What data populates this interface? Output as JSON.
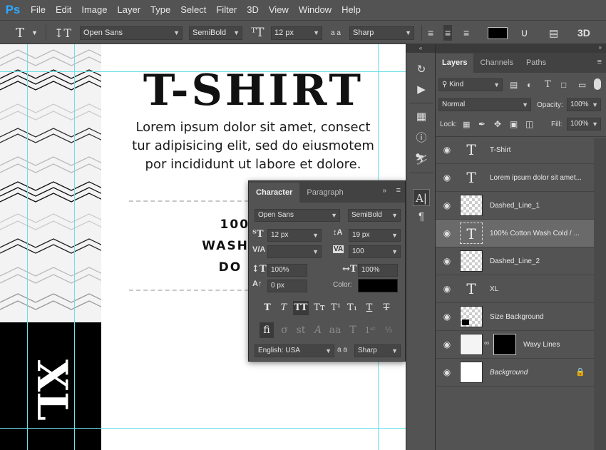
{
  "app": {
    "logo": "Ps"
  },
  "menu": [
    "File",
    "Edit",
    "Image",
    "Layer",
    "Type",
    "Select",
    "Filter",
    "3D",
    "View",
    "Window",
    "Help"
  ],
  "options_bar": {
    "font_family": "Open Sans",
    "font_style": "SemiBold",
    "font_size": "12 px",
    "aa_label": "a a",
    "antialias": "Sharp",
    "label_3d": "3D",
    "color": "#000000"
  },
  "canvas": {
    "title": "T-SHIRT",
    "lorem_lines": [
      "Lorem ipsum dolor sit amet, consect",
      "tur adipisicing elit, sed do eiusmotem",
      "por incididunt ut labore et dolore."
    ],
    "cotton_lines": [
      "100% C",
      "WASH COLD",
      "DO NOT"
    ],
    "size": "XL"
  },
  "character_panel": {
    "tabs": [
      "Character",
      "Paragraph"
    ],
    "font_family": "Open Sans",
    "font_style": "SemiBold",
    "font_size": "12 px",
    "leading": "19 px",
    "kerning": "",
    "tracking": "100",
    "vertical_scale": "100%",
    "horizontal_scale": "100%",
    "baseline_shift": "0 px",
    "color_label": "Color:",
    "color": "#000000",
    "language": "English: USA",
    "aa_label": "a a",
    "antialias": "Sharp"
  },
  "layers_panel": {
    "tabs": [
      "Layers",
      "Channels",
      "Paths"
    ],
    "filter": "Kind",
    "blend_mode": "Normal",
    "opacity_label": "Opacity:",
    "opacity": "100%",
    "lock_label": "Lock:",
    "fill_label": "Fill:",
    "fill": "100%",
    "layers": [
      {
        "name": "T-Shirt",
        "kind": "type",
        "selected": false
      },
      {
        "name": "Lorem ipsum dolor sit amet...",
        "kind": "type",
        "selected": false
      },
      {
        "name": "Dashed_Line_1",
        "kind": "shape",
        "selected": false
      },
      {
        "name": "100% Cotton Wash Cold / ...",
        "kind": "type",
        "selected": true
      },
      {
        "name": "Dashed_Line_2",
        "kind": "shape",
        "selected": false
      },
      {
        "name": "XL",
        "kind": "type",
        "selected": false
      },
      {
        "name": "Size Background",
        "kind": "shape",
        "selected": false
      },
      {
        "name": "Wavy Lines",
        "kind": "masked",
        "selected": false
      },
      {
        "name": "Background",
        "kind": "background",
        "selected": false
      }
    ]
  }
}
